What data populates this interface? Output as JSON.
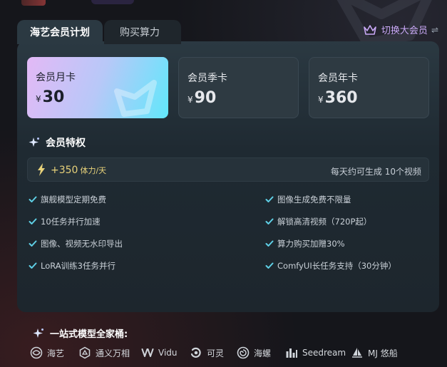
{
  "tabs": [
    {
      "label": "海艺会员计划",
      "active": true
    },
    {
      "label": "购买算力",
      "active": false
    }
  ],
  "switch_link": {
    "label": "切换大会员",
    "icon": "crown-icon",
    "arrow_icon": "swap-arrows-icon",
    "color": "#c9a8f6"
  },
  "plans": [
    {
      "name": "会员月卡",
      "currency": "¥",
      "price": "30",
      "selected": true
    },
    {
      "name": "会员季卡",
      "currency": "¥",
      "price": "90",
      "selected": false
    },
    {
      "name": "会员年卡",
      "currency": "¥",
      "price": "360",
      "selected": false
    }
  ],
  "perks": {
    "title": "会员特权",
    "energy": {
      "amount": "+350",
      "unit": "体力/天",
      "note": "每天约可生成 10个视频"
    },
    "features": [
      "旗舰模型定期免费",
      "图像生成免费不限量",
      "10任务并行加速",
      "解锁高清视频（720P起）",
      "图像、视频无水印导出",
      "算力购买加赠30%",
      "LoRA训练3任务并行",
      "ComfyUI长任务支持（30分钟）"
    ]
  },
  "onestop": {
    "title": "一站式模型全家桶:"
  },
  "models": [
    {
      "name": "海艺",
      "icon": "haiyi-icon"
    },
    {
      "name": "通义万相",
      "icon": "tongyi-icon"
    },
    {
      "name": "Vidu",
      "icon": "vidu-icon"
    },
    {
      "name": "可灵",
      "icon": "kling-icon"
    },
    {
      "name": "海螺",
      "icon": "hailuo-icon"
    },
    {
      "name": "Seedream",
      "icon": "seedream-icon"
    },
    {
      "name": "MJ 悠船",
      "icon": "mj-icon"
    }
  ],
  "colors": {
    "accent_cyan": "#61e7fb",
    "accent_pink": "#e3b9f6",
    "energy": "#e8d27a",
    "check": "#5fd0e6"
  }
}
